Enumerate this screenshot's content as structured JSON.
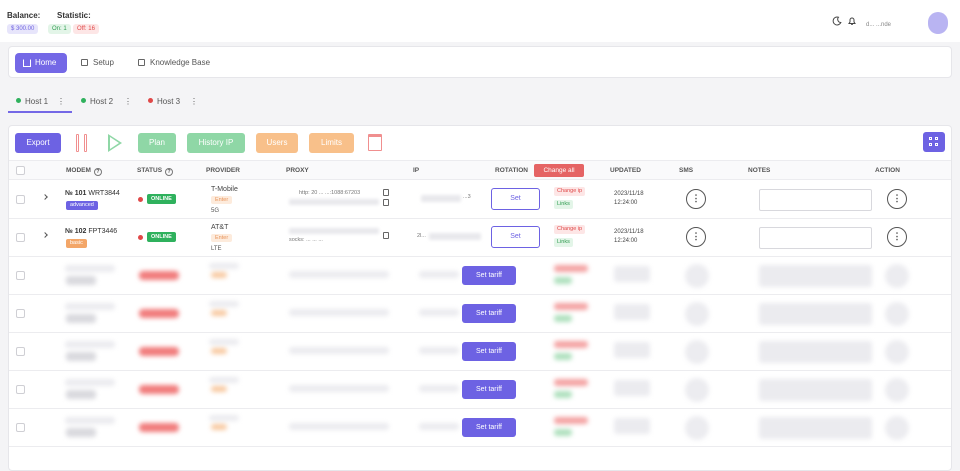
{
  "topbar": {
    "balance_label": "Balance:",
    "balance_value": "$ 300.00",
    "statistic_label": "Statistic:",
    "on_badge": "On: 1",
    "off_badge": "Off: 16",
    "user_name": "d... ...nde",
    "icons": [
      "moon-icon",
      "bell-icon",
      "avatar"
    ]
  },
  "nav": {
    "home": "Home",
    "setup": "Setup",
    "knowledge": "Knowledge Base"
  },
  "hosts": [
    {
      "label": "Host 1",
      "color": "#2fb15d"
    },
    {
      "label": "Host 2",
      "color": "#2fb15d"
    },
    {
      "label": "Host 3",
      "color": "#e04848"
    }
  ],
  "toolbar": {
    "export": "Export",
    "plan": "Plan",
    "history_ip": "History IP",
    "users": "Users",
    "limits": "Limits"
  },
  "table": {
    "headers": {
      "modem": "MODEM",
      "status": "STATUS",
      "provider": "PROVIDER",
      "proxy": "PROXY",
      "ip": "IP",
      "rotation": "ROTATION",
      "change_all": "Change all",
      "updated": "UPDATED",
      "sms": "SMS",
      "notes": "NOTES",
      "action": "ACTION"
    },
    "rows": [
      {
        "num": "№ 101",
        "model": "WRT3844",
        "tag": "advanced",
        "status": "ONLINE",
        "provider": "T-Mobile",
        "provider_tag": "Enter",
        "network": "5G",
        "proxy_line1": "http: 20 ... ...:1088:67203",
        "ip": "...3",
        "set": "Set",
        "change_ip": "Change ip",
        "links": "Links",
        "updated_date": "2023/11/18",
        "updated_time": "12:24:00",
        "menu": "⋮"
      },
      {
        "num": "№ 102",
        "model": "FPT3446",
        "tag": "basic",
        "status": "ONLINE",
        "provider": "AT&T",
        "provider_tag": "Enter",
        "network": "LTE",
        "proxy_line1": "socks: ... ... ...",
        "ip": "2l...",
        "set": "Set",
        "change_ip": "Change ip",
        "links": "Links",
        "updated_date": "2023/11/18",
        "updated_time": "12:24:00",
        "menu": "⋮"
      }
    ],
    "set_tariff": "Set tariff"
  }
}
